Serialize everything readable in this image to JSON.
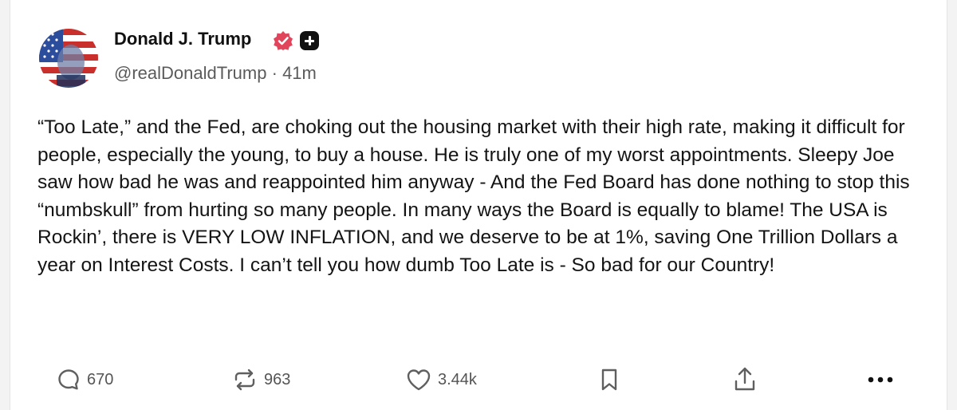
{
  "post": {
    "author": {
      "name": "Donald J. Trump",
      "handle": "@realDonaldTrump",
      "separator": "·",
      "time": "41m",
      "verified_icon": "verified-badge-icon",
      "plus_icon": "plus-badge-icon"
    },
    "body": "“Too Late,” and the Fed, are choking out the housing market with their high rate, making it difficult for people, especially the young, to buy a house. He is truly one of my worst appointments. Sleepy Joe saw how bad he was and reappointed him anyway - And the Fed Board has done nothing to stop this “numbskull” from hurting so many people. In many ways the Board is equally to blame! The USA is Rockin’, there is VERY LOW INFLATION, and we deserve to be at 1%, saving One Trillion Dollars a year on Interest Costs. I can’t tell you how dumb Too Late is - So bad for our Country!",
    "actions": {
      "replies": "670",
      "reposts": "963",
      "likes": "3.44k"
    }
  },
  "colors": {
    "verified": "#e0455c",
    "text": "#141414",
    "muted": "#555555",
    "icon": "#5f5f5f"
  }
}
